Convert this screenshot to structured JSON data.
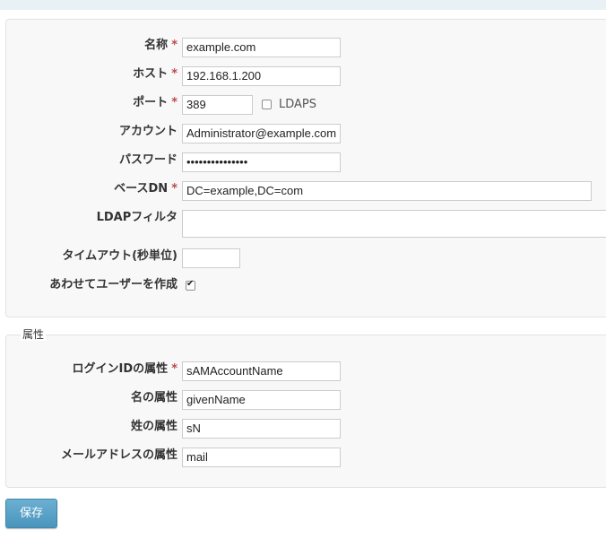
{
  "form": {
    "name": {
      "label": "名称",
      "value": "example.com",
      "required": "*"
    },
    "host": {
      "label": "ホスト",
      "value": "192.168.1.200",
      "required": "*"
    },
    "port": {
      "label": "ポート",
      "value": "389",
      "required": "*"
    },
    "ldaps": {
      "label": "LDAPS",
      "checked": false
    },
    "account": {
      "label": "アカウント",
      "value": "Administrator@example.com"
    },
    "password": {
      "label": "パスワード",
      "value": "•••••••••••••••"
    },
    "base_dn": {
      "label": "ベースDN",
      "value": "DC=example,DC=com",
      "required": "*"
    },
    "ldap_filter": {
      "label": "LDAPフィルタ",
      "value": ""
    },
    "timeout": {
      "label": "タイムアウト(秒単位)",
      "value": ""
    },
    "create_user": {
      "label": "あわせてユーザーを作成",
      "checked": true
    }
  },
  "attributes": {
    "legend": "属性",
    "login_id": {
      "label": "ログインIDの属性",
      "value": "sAMAccountName",
      "required": "*"
    },
    "given_name": {
      "label": "名の属性",
      "value": "givenName"
    },
    "surname": {
      "label": "姓の属性",
      "value": "sN"
    },
    "email": {
      "label": "メールアドレスの属性",
      "value": "mail"
    }
  },
  "save_button": "保存",
  "colors": {
    "accent": "#5ba3c9",
    "required": "#b94a48",
    "panel_bg": "#f8f8f8",
    "topbar": "#e8f1f5"
  }
}
